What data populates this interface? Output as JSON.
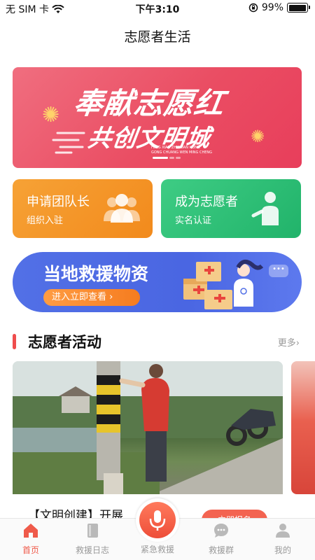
{
  "status_bar": {
    "carrier": "无 SIM 卡",
    "time": "下午3:10",
    "battery": "99%",
    "battery_level": 0.99
  },
  "page_title": "志愿者生活",
  "banner": {
    "line1": "奉献志愿红",
    "line2": "共创文明城",
    "pinyin1": "FENG XIAN ZHI YUAN HONG",
    "pinyin2": "GONG CHUANG WEN MING CHENG",
    "active_slide": 1,
    "slide_count": 3
  },
  "cards": [
    {
      "title": "申请团队长",
      "subtitle": "组织入驻",
      "icon": "team-icon"
    },
    {
      "title": "成为志愿者",
      "subtitle": "实名认证",
      "icon": "volunteer-icon"
    }
  ],
  "supplies": {
    "title": "当地救援物资",
    "button": "进入立即查看 ›"
  },
  "section": {
    "title": "志愿者活动",
    "more": "更多›"
  },
  "activity": {
    "title": "【文明创建】开展",
    "button_partial": "立即报名"
  },
  "tabs": [
    {
      "label": "首页",
      "icon": "home-icon",
      "active": true
    },
    {
      "label": "救援日志",
      "icon": "log-icon",
      "active": false
    },
    {
      "label": "紧急救援",
      "icon": "sos-icon",
      "active": false
    },
    {
      "label": "救援群",
      "icon": "chat-icon",
      "active": false
    },
    {
      "label": "我的",
      "icon": "profile-icon",
      "active": false
    }
  ],
  "colors": {
    "accent": "#ef5a4a",
    "banner": "#ea4d63",
    "orange_card": "#f28a1c",
    "green_card": "#21b36a",
    "supplies": "#4a66e2"
  }
}
